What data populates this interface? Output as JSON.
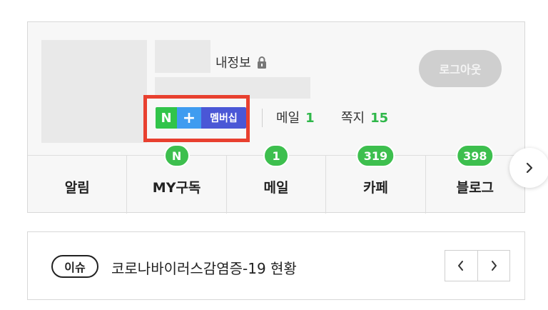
{
  "account": {
    "my_info_label": "내정보",
    "logout_label": "로그아웃",
    "membership": {
      "n_label": "N",
      "plus_label": "+",
      "label": "멤버십"
    },
    "mail": {
      "label": "메일",
      "count": "1"
    },
    "notes": {
      "label": "쪽지",
      "count": "15"
    },
    "tabs": [
      {
        "label": "알림",
        "badge": ""
      },
      {
        "label": "MY구독",
        "badge": "N"
      },
      {
        "label": "메일",
        "badge": "1"
      },
      {
        "label": "카페",
        "badge": "319"
      },
      {
        "label": "블로그",
        "badge": "398"
      }
    ],
    "colors": {
      "badge_green": "#3dbf4e",
      "membership_blue": "#4a57d6",
      "highlight_red": "#e8402f"
    }
  },
  "issue": {
    "tag_label": "이슈",
    "headline": "코로나바이러스감염증-19 현황"
  }
}
